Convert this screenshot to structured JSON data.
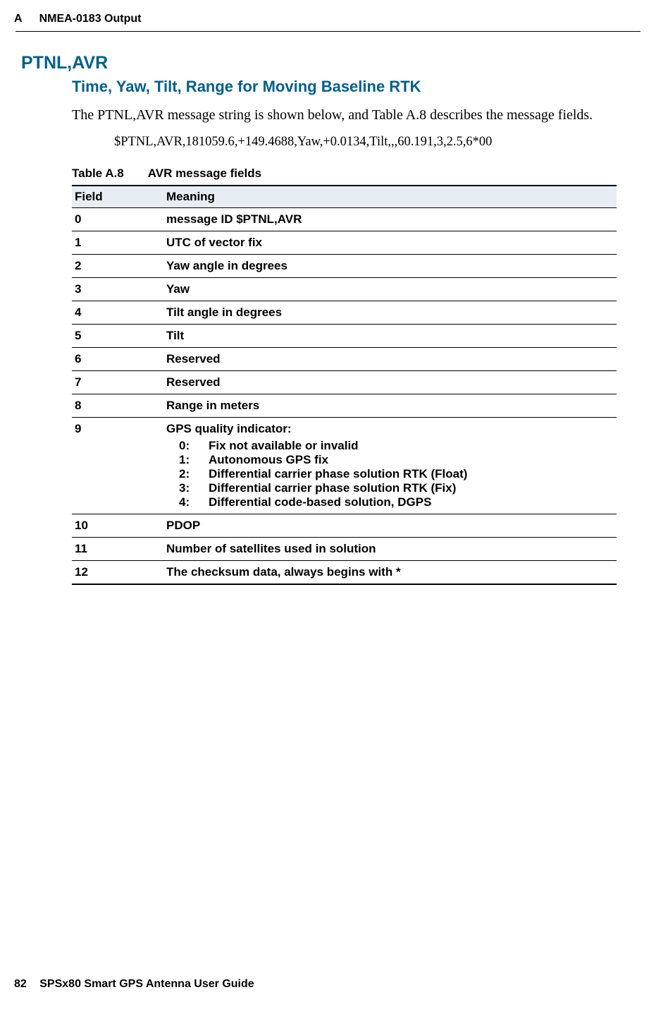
{
  "header": {
    "appendix": "A",
    "title": "NMEA-0183 Output"
  },
  "section": {
    "title": "PTNL,AVR",
    "subtitle": "Time, Yaw, Tilt, Range for Moving Baseline RTK",
    "body": "The PTNL,AVR message string is shown below, and Table A.8 describes the message fields.",
    "msg_string": "$PTNL,AVR,181059.6,+149.4688,Yaw,+0.0134,Tilt,,,60.191,3,2.5,6*00"
  },
  "table": {
    "caption_label": "Table A.8",
    "caption_title": "AVR message fields",
    "headers": {
      "field": "Field",
      "meaning": "Meaning"
    },
    "rows": [
      {
        "f": "0",
        "m": "message ID $PTNL,AVR"
      },
      {
        "f": "1",
        "m": "UTC of vector fix"
      },
      {
        "f": "2",
        "m": "Yaw angle in degrees"
      },
      {
        "f": "3",
        "m": "Yaw"
      },
      {
        "f": "4",
        "m": "Tilt angle in degrees"
      },
      {
        "f": "5",
        "m": "Tilt"
      },
      {
        "f": "6",
        "m": "Reserved"
      },
      {
        "f": "7",
        "m": "Reserved"
      },
      {
        "f": "8",
        "m": "Range in meters"
      },
      {
        "f": "9",
        "m": "GPS quality indicator:",
        "sub": [
          {
            "n": "0:",
            "t": "Fix not available or invalid"
          },
          {
            "n": "1:",
            "t": "Autonomous GPS fix"
          },
          {
            "n": "2:",
            "t": "Differential carrier phase solution RTK (Float)"
          },
          {
            "n": "3:",
            "t": "Differential carrier phase solution RTK (Fix)"
          },
          {
            "n": "4:",
            "t": "Differential code-based solution, DGPS"
          }
        ]
      },
      {
        "f": "10",
        "m": "PDOP"
      },
      {
        "f": "11",
        "m": "Number of satellites used in solution"
      },
      {
        "f": "12",
        "m": "The checksum data, always begins with *"
      }
    ]
  },
  "footer": {
    "page": "82",
    "guide": "SPSx80 Smart GPS Antenna User Guide"
  }
}
